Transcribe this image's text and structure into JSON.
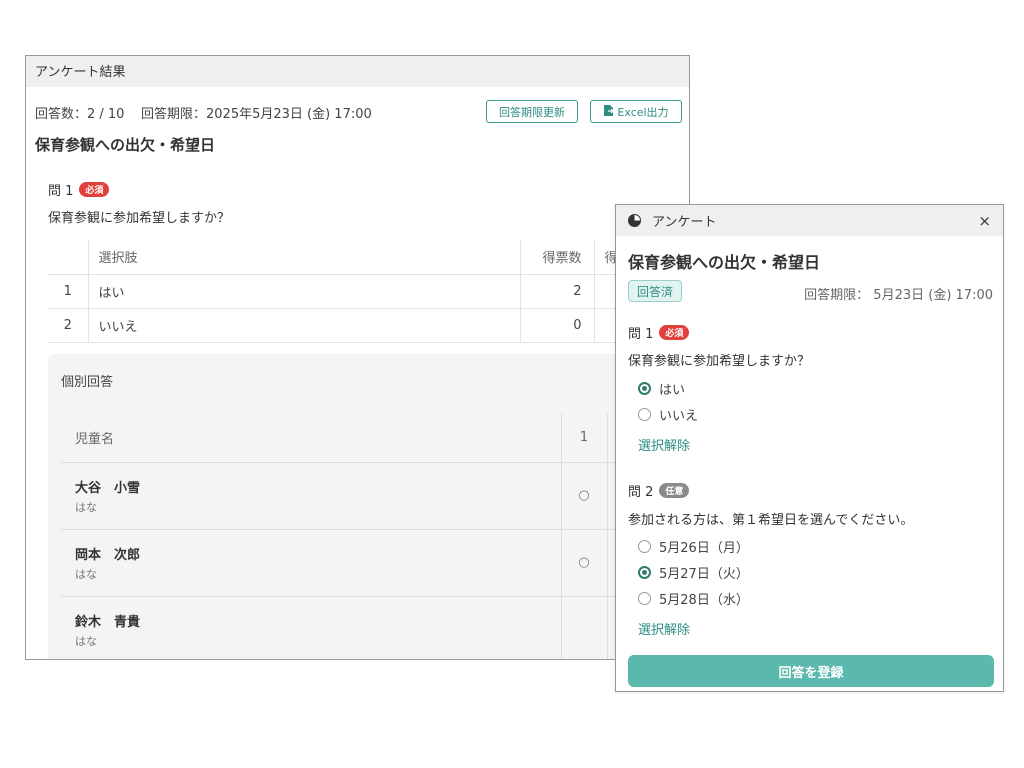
{
  "results": {
    "window_title": "アンケート結果",
    "response_count": "回答数：2 / 10",
    "deadline": "回答期限：2025年5月23日 (金) 17:00",
    "renew_button": "回答期限更新",
    "excel_button": "Excel出力",
    "survey_title": "保育参観への出欠・希望日",
    "question": {
      "label": "問 1",
      "badge": "必須",
      "text": "保育参観に参加希望しますか？"
    },
    "table": {
      "headers": [
        "",
        "選択肢",
        "得票数",
        "得"
      ],
      "rows": [
        {
          "no": "1",
          "label": "はい",
          "votes": "2"
        },
        {
          "no": "2",
          "label": "いいえ",
          "votes": "0"
        }
      ]
    },
    "individual": {
      "title": "個別回答",
      "header_name": "児童名",
      "header_col1": "1",
      "rows": [
        {
          "name": "大谷　小雪",
          "sub": "はな",
          "ans": "○"
        },
        {
          "name": "岡本　次郎",
          "sub": "はな",
          "ans": "○"
        },
        {
          "name": "鈴木　青貴",
          "sub": "はな",
          "ans": ""
        }
      ]
    }
  },
  "popup": {
    "window_title": "アンケート",
    "close": "×",
    "title": "保育参観への出欠・希望日",
    "status_badge": "回答済",
    "deadline": "回答期限： 5月23日 (金) 17:00",
    "q1": {
      "label": "問 1",
      "badge": "必須",
      "text": "保育参観に参加希望しますか？",
      "options": [
        {
          "label": "はい",
          "checked": true
        },
        {
          "label": "いいえ",
          "checked": false
        }
      ],
      "clear": "選択解除"
    },
    "q2": {
      "label": "問 2",
      "badge": "任意",
      "text": "参加される方は、第１希望日を選んでください。",
      "options": [
        {
          "label": "5月26日（月）",
          "checked": false
        },
        {
          "label": "5月27日（火）",
          "checked": true
        },
        {
          "label": "5月28日（水）",
          "checked": false
        }
      ],
      "clear": "選択解除"
    },
    "submit": "回答を登録"
  },
  "colors": {
    "accent": "#2e8c80",
    "required": "#e0413b",
    "optional": "#8a8a8a",
    "submit": "#5bb8ac"
  }
}
